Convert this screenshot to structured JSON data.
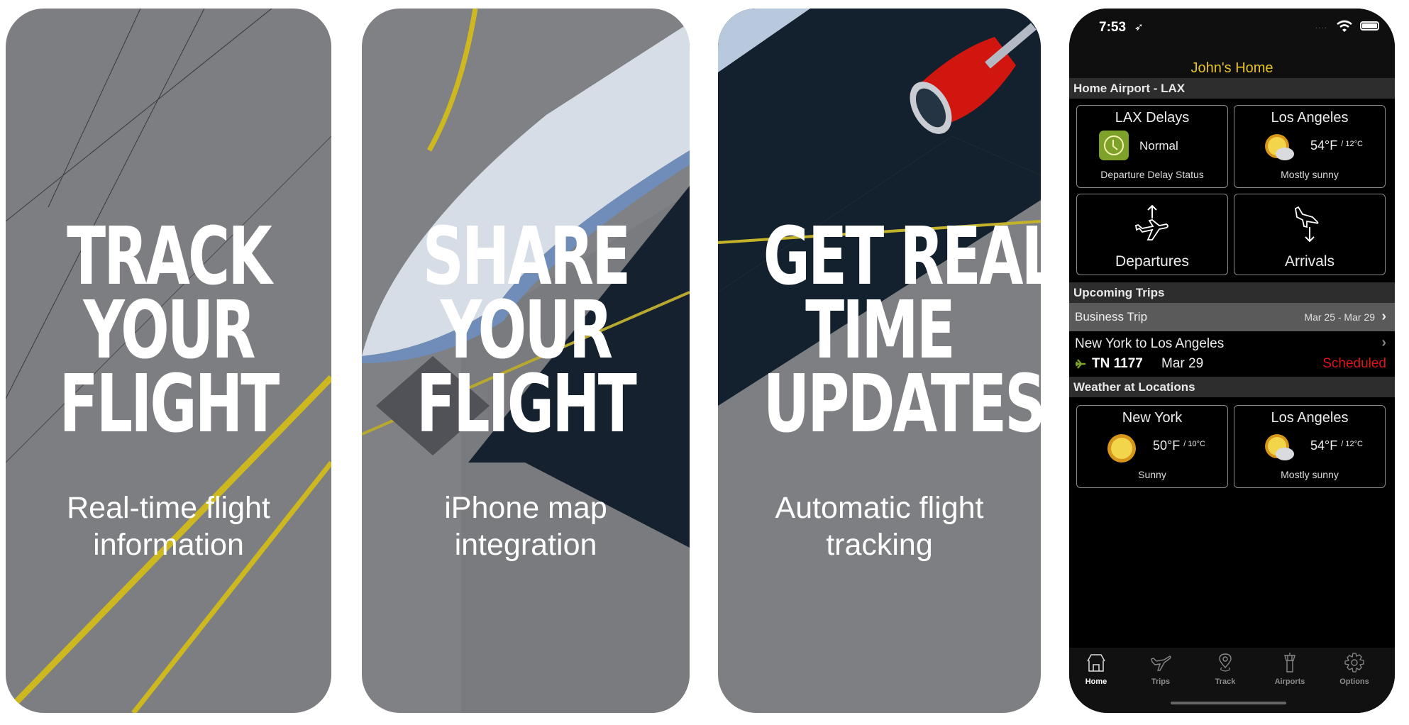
{
  "panels": [
    {
      "headline": [
        "TRACK",
        "YOUR",
        "FLIGHT"
      ],
      "subtitle": [
        "Real-time flight",
        "information"
      ]
    },
    {
      "headline": [
        "SHARE",
        "YOUR",
        "FLIGHT"
      ],
      "subtitle": [
        "iPhone map",
        "integration"
      ]
    },
    {
      "headline": [
        "GET REAL",
        "TIME",
        "UPDATES"
      ],
      "subtitle": [
        "Automatic flight",
        "tracking"
      ]
    }
  ],
  "phone": {
    "status_bar": {
      "time": "7:53",
      "location_glyph": "➶",
      "signal": "····"
    },
    "title": "John's Home",
    "home_airport": {
      "header": "Home Airport - LAX",
      "delays": {
        "title": "LAX Delays",
        "status": "Normal",
        "subtitle": "Departure Delay Status"
      },
      "weather": {
        "city": "Los Angeles",
        "temp_f": "54°F",
        "temp_c": "/ 12°C",
        "condition": "Mostly sunny"
      },
      "departures_label": "Departures",
      "arrivals_label": "Arrivals"
    },
    "upcoming_trips": {
      "header": "Upcoming Trips",
      "trip": {
        "name": "Business Trip",
        "dates": "Mar 25 - Mar 29"
      },
      "flight": {
        "route": "New York to Los Angeles",
        "number": "TN 1177",
        "date": "Mar 29",
        "status": "Scheduled"
      }
    },
    "weather_locations": {
      "header": "Weather at Locations",
      "items": [
        {
          "city": "New York",
          "temp_f": "50°F",
          "temp_c": "/ 10°C",
          "condition": "Sunny"
        },
        {
          "city": "Los Angeles",
          "temp_f": "54°F",
          "temp_c": "/ 12°C",
          "condition": "Mostly sunny"
        }
      ]
    },
    "tabs": [
      {
        "label": "Home",
        "icon": "home-icon",
        "active": true
      },
      {
        "label": "Trips",
        "icon": "plane-icon",
        "active": false
      },
      {
        "label": "Track",
        "icon": "location-pin-icon",
        "active": false
      },
      {
        "label": "Airports",
        "icon": "control-tower-icon",
        "active": false
      },
      {
        "label": "Options",
        "icon": "gear-icon",
        "active": false
      }
    ],
    "colors": {
      "title": "#e6c229",
      "status_scheduled": "#d9151b",
      "delay_badge": "#7ea12a",
      "flight_icon": "#7ea12a"
    }
  }
}
